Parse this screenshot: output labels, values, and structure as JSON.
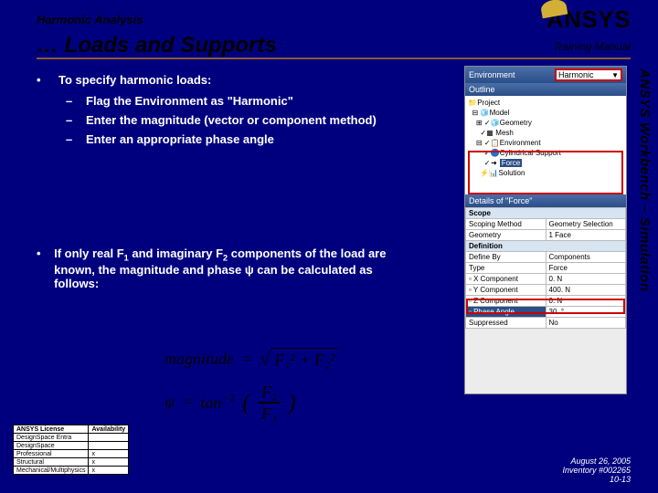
{
  "header": {
    "kicker": "Harmonic Analysis",
    "title": "… Loads and Supports",
    "logo": "ANSYS",
    "manual": "Training Manual"
  },
  "side_label": "ANSYS Workbench – Simulation",
  "bullets": {
    "b1": "To specify harmonic loads:",
    "s1": "Flag the Environment as \"Harmonic\"",
    "s2": "Enter the magnitude (vector or component method)",
    "s3": "Enter an appropriate phase angle",
    "b2_pre": "If only real F",
    "b2_mid1": " and imaginary F",
    "b2_mid2": " components of the load are known, the magnitude and phase ψ can be calculated as follows:"
  },
  "formula": {
    "mag_lhs": "magnitude",
    "eq": "=",
    "f1sq": "F₁²",
    "plus": "+",
    "f2sq": "F₂²",
    "psi": "ψ",
    "tan": "tan",
    "neg1": "−1",
    "F2": "F₂",
    "F1": "F₁"
  },
  "screenshot": {
    "env_label": "Environment",
    "combo_value": "Harmonic",
    "outline_label": "Outline",
    "tree": {
      "project": "Project",
      "model": "Model",
      "geometry": "Geometry",
      "mesh": "Mesh",
      "environment": "Environment",
      "cylsupport": "Cylindrical Support",
      "force": "Force",
      "solution": "Solution"
    },
    "details_label": "Details of \"Force\"",
    "groups": {
      "scope": "Scope",
      "definition": "Definition"
    },
    "rows": {
      "scoping_method": {
        "label": "Scoping Method",
        "value": "Geometry Selection"
      },
      "geometry": {
        "label": "Geometry",
        "value": "1 Face"
      },
      "define_by": {
        "label": "Define By",
        "value": "Components"
      },
      "type": {
        "label": "Type",
        "value": "Force"
      },
      "x": {
        "label": "X Component",
        "value": "0. N"
      },
      "y": {
        "label": "Y Component",
        "value": "400. N"
      },
      "z": {
        "label": "Z Component",
        "value": "0. N"
      },
      "phase": {
        "label": "Phase Angle",
        "value": "30. °"
      },
      "suppressed": {
        "label": "Suppressed",
        "value": "No"
      }
    }
  },
  "license_table": {
    "headers": {
      "lic": "ANSYS License",
      "avail": "Availability"
    },
    "rows": [
      {
        "lic": "DesignSpace Entra",
        "avail": ""
      },
      {
        "lic": "DesignSpace",
        "avail": ""
      },
      {
        "lic": "Professional",
        "avail": "x"
      },
      {
        "lic": "Structural",
        "avail": "x"
      },
      {
        "lic": "Mechanical/Multiphysics",
        "avail": "x"
      }
    ]
  },
  "footer": {
    "date": "August 26, 2005",
    "inv": "Inventory #002265",
    "page": "10-13"
  }
}
